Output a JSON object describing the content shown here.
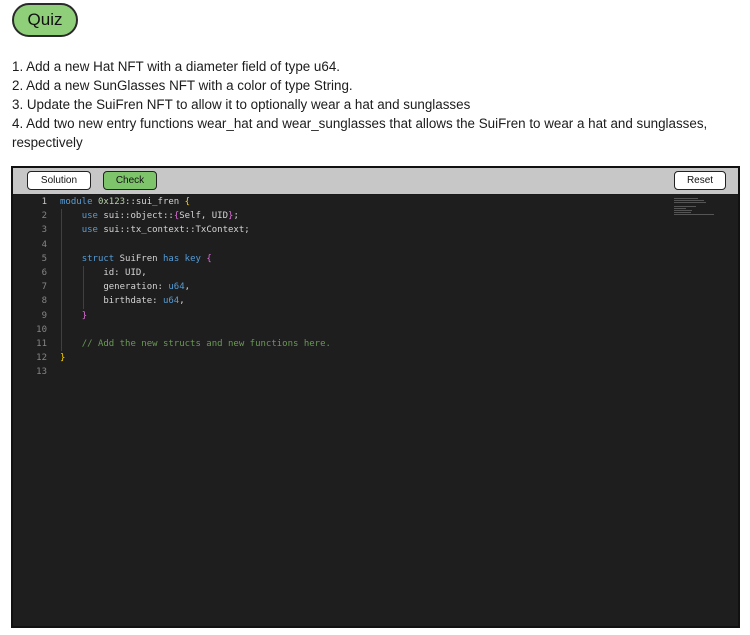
{
  "quiz": {
    "label": "Quiz"
  },
  "instructions": [
    "1. Add a new Hat NFT with a diameter field of type u64.",
    "2. Add a new SunGlasses NFT with a color of type String.",
    "3. Update the SuiFren NFT to allow it to optionally wear a hat and sunglasses",
    "4. Add two new entry functions wear_hat and wear_sunglasses that allows the SuiFren to wear a hat and sunglasses, respectively"
  ],
  "toolbar": {
    "solution_label": "Solution",
    "check_label": "Check",
    "reset_label": "Reset"
  },
  "editor": {
    "line_numbers": [
      "1",
      "2",
      "3",
      "4",
      "5",
      "6",
      "7",
      "8",
      "9",
      "10",
      "11",
      "12",
      "13"
    ],
    "active_line": "1",
    "lines": [
      "module 0x123::sui_fren {",
      "    use sui::object::{Self, UID};",
      "    use sui::tx_context::TxContext;",
      "",
      "    struct SuiFren has key {",
      "        id: UID,",
      "        generation: u64,",
      "        birthdate: u64,",
      "    }",
      "",
      "    // Add the new structs and new functions here.",
      "}",
      ""
    ]
  },
  "colors": {
    "quiz_pill": "#8fcf7a",
    "check_button": "#7ec46b",
    "editor_bg": "#1e1e1e",
    "toolbar_bg": "#c7c7c7"
  }
}
